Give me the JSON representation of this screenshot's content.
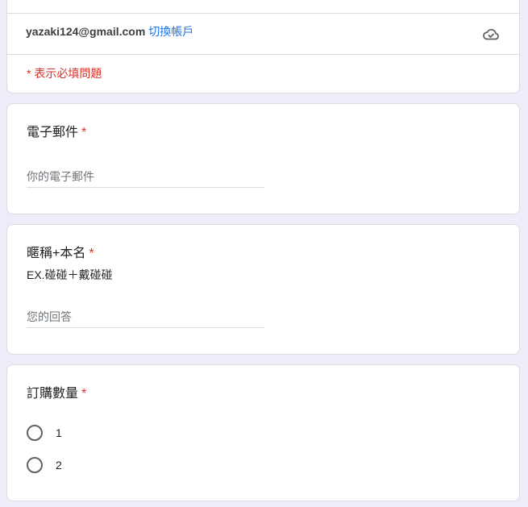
{
  "header": {
    "account_email": "yazaki124@gmail.com",
    "switch_account_label": "切換帳戶",
    "cloud_icon": "cloud-check-icon",
    "required_note": "* 表示必填問題"
  },
  "questions": [
    {
      "title": "電子郵件",
      "required_mark": "*",
      "placeholder": "你的電子郵件",
      "value": ""
    },
    {
      "title": "暱稱+本名",
      "required_mark": "*",
      "description": "EX.碰碰＋戴碰碰",
      "placeholder": "您的回答",
      "value": ""
    },
    {
      "title": "訂購數量",
      "required_mark": "*",
      "options": [
        "1",
        "2"
      ]
    }
  ],
  "colors": {
    "background": "#f0ebf8",
    "accent_link": "#1a73e8",
    "required": "#d93025"
  }
}
